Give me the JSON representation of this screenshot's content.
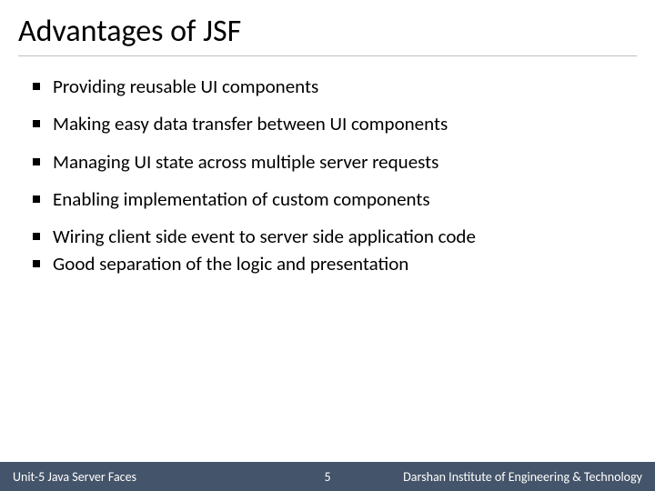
{
  "title": "Advantages of JSF",
  "bullets": [
    "Providing reusable UI components",
    "Making easy data transfer between UI components",
    "Managing UI state across multiple server requests",
    "Enabling implementation of custom components",
    "Wiring client side event to server side application code",
    "Good separation of the logic and presentation"
  ],
  "footer": {
    "left": "Unit-5 Java Server Faces",
    "page": "5",
    "right": "Darshan Institute of Engineering & Technology"
  }
}
